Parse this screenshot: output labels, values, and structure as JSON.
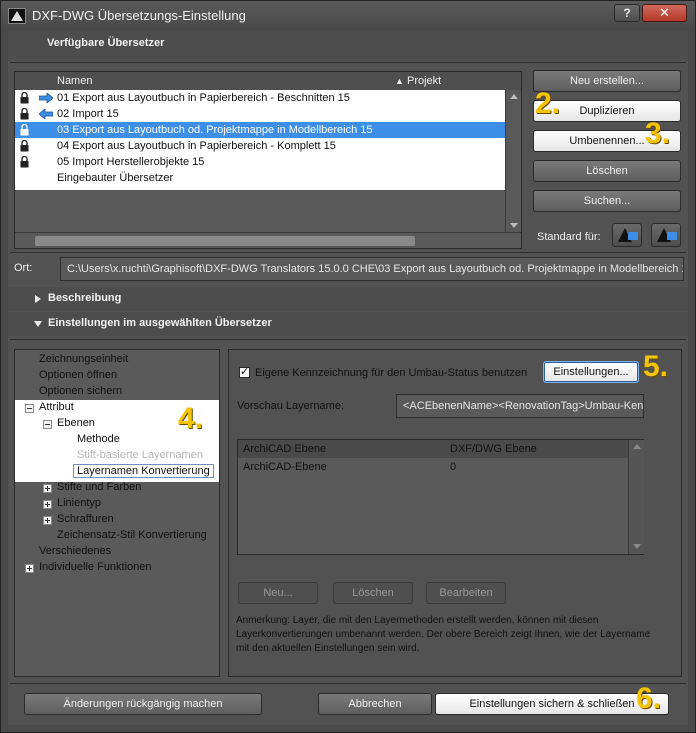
{
  "window": {
    "title": "DXF-DWG Übersetzungs-Einstellung",
    "help_label": "?",
    "close_label": "✕"
  },
  "translators": {
    "section_label": "Verfügbare Übersetzer",
    "columns": {
      "name": "Namen",
      "project": "Projekt"
    },
    "rows": [
      {
        "label": "01 Export aus Layoutbuch in Papierbereich - Beschnitten 15",
        "direction": "export",
        "selected": false
      },
      {
        "label": "02 Import 15",
        "direction": "import",
        "selected": false
      },
      {
        "label": "03 Export aus Layoutbuch od. Projektmappe in Modellbereich 15",
        "direction": "export",
        "selected": true
      },
      {
        "label": "04 Export aus Layoutbuch in Papierbereich - Komplett 15",
        "direction": "none",
        "selected": false
      },
      {
        "label": "05 Import Herstellerobjekte 15",
        "direction": "none",
        "selected": false
      },
      {
        "label": "Eingebauter Übersetzer",
        "direction": "none",
        "selected": false
      }
    ]
  },
  "buttons": {
    "new": "Neu erstellen...",
    "duplicate": "Duplizieren",
    "rename": "Umbenennen...",
    "delete": "Löschen",
    "search": "Suchen..."
  },
  "standard_for": "Standard für:",
  "location": {
    "label": "Ort:",
    "path": "C:\\Users\\x.ruchti\\Graphisoft\\DXF-DWG Translators 15.0.0 CHE\\03 Export aus Layoutbuch od. Projektmappe in Modellbereich 15"
  },
  "sections": {
    "description": "Beschreibung",
    "settings": "Einstellungen im ausgewählten Übersetzer"
  },
  "tree": {
    "items": [
      {
        "label": "Zeichnungseinheit"
      },
      {
        "label": "Optionen öffnen"
      },
      {
        "label": "Optionen sichern"
      },
      {
        "label": "Attribut"
      },
      {
        "label": "Ebenen"
      },
      {
        "label": "Methode"
      },
      {
        "label": "Stift-basierte Layernamen"
      },
      {
        "label": "Layernamen Konvertierung"
      },
      {
        "label": "Stifte und Farben"
      },
      {
        "label": "Linientyp"
      },
      {
        "label": "Schraffuren"
      },
      {
        "label": "Zeichensatz-Stil Konvertierung"
      },
      {
        "label": "Verschiedenes"
      },
      {
        "label": "Individuelle Funktionen"
      }
    ]
  },
  "settings_panel": {
    "checkbox_label": "Eigene Kennzeichnung für den Umbau-Status benutzen",
    "checkbox_checked": true,
    "settings_button": "Einstellungen...",
    "preview_label": "Vorschau Layername:",
    "preview_value": "<ACEbenenName><RenovationTag>Umbau-Kenn",
    "table": {
      "columns": [
        "ArchiCAD Ebene",
        "DXF/DWG Ebene"
      ],
      "rows": [
        [
          "ArchiCAD-Ebene",
          "0"
        ]
      ]
    },
    "row_buttons": {
      "new": "Neu...",
      "delete": "Löschen",
      "edit": "Bearbeiten"
    },
    "note": "Anmerkung: Layer, die mit den Layermethoden erstellt werden, können mit diesen Layerkonvertierungen umbenannt werden. Der obere Bereich zeigt Ihnen, wie der Layername mit den aktuellen Einstellungen sein wird."
  },
  "footer": {
    "undo": "Änderungen rückgängig machen",
    "cancel": "Abbrechen",
    "save_close": "Einstellungen sichern & schließen"
  },
  "callouts": {
    "n2": "2.",
    "n3": "3.",
    "n4": "4.",
    "n5": "5.",
    "n6": "6."
  },
  "colors": {
    "accent_selection": "#3d8ee6",
    "callout": "#f5c400",
    "window_bg": "#525252"
  }
}
